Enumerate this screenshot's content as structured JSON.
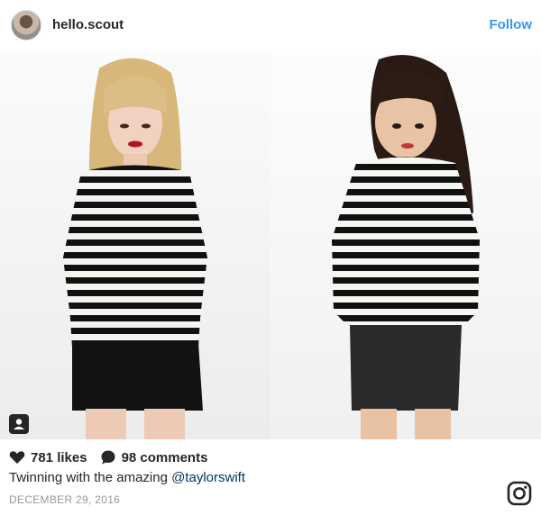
{
  "header": {
    "username": "hello.scout",
    "follow_label": "Follow"
  },
  "post": {
    "photo_icon": "user-tag-icon"
  },
  "actions": {
    "likes": "781 likes",
    "comments": "98 comments"
  },
  "caption": {
    "text": "Twinning with the amazing ",
    "mention": "@taylorswift"
  },
  "date": "DECEMBER 29, 2016",
  "icons": {
    "like": "heart-icon",
    "comment": "comment-bubble-icon",
    "brand": "instagram-logo-icon"
  },
  "colors": {
    "follow": "#3897f0",
    "mention": "#003569",
    "date": "#999999"
  }
}
